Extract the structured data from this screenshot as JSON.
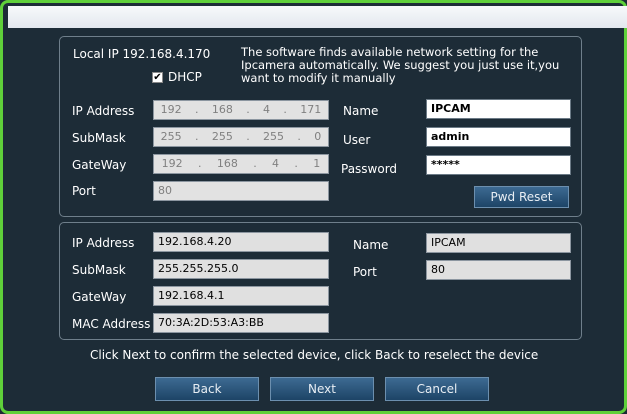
{
  "local": {
    "ip_text": "Local IP 192.168.4.170",
    "dhcp_label": "DHCP",
    "dhcp_checked": true
  },
  "hint": "The software finds available network setting for the Ipcamera automatically. We suggest you just use it,you want to modify it manually",
  "top": {
    "ip_label": "IP Address",
    "ip": [
      "192",
      "168",
      "4",
      "171"
    ],
    "mask_label": "SubMask",
    "mask": [
      "255",
      "255",
      "255",
      "0"
    ],
    "gw_label": "GateWay",
    "gw": [
      "192",
      "168",
      "4",
      "1"
    ],
    "port_label": "Port",
    "port": "80",
    "name_label": "Name",
    "name": "IPCAM",
    "user_label": "User",
    "user": "admin",
    "pwd_label": "Password",
    "pwd": "*****",
    "pwd_reset": "Pwd Reset"
  },
  "device": {
    "ip_label": "IP Address",
    "ip": "192.168.4.20",
    "mask_label": "SubMask",
    "mask": "255.255.255.0",
    "gw_label": "GateWay",
    "gw": "192.168.4.1",
    "mac_label": "MAC Address",
    "mac": "70:3A:2D:53:A3:BB",
    "name_label": "Name",
    "name": "IPCAM",
    "port_label": "Port",
    "port": "80"
  },
  "footer": {
    "instruction": "Click Next to confirm the selected device, click Back to reselect the device",
    "back": "Back",
    "next": "Next",
    "cancel": "Cancel"
  }
}
